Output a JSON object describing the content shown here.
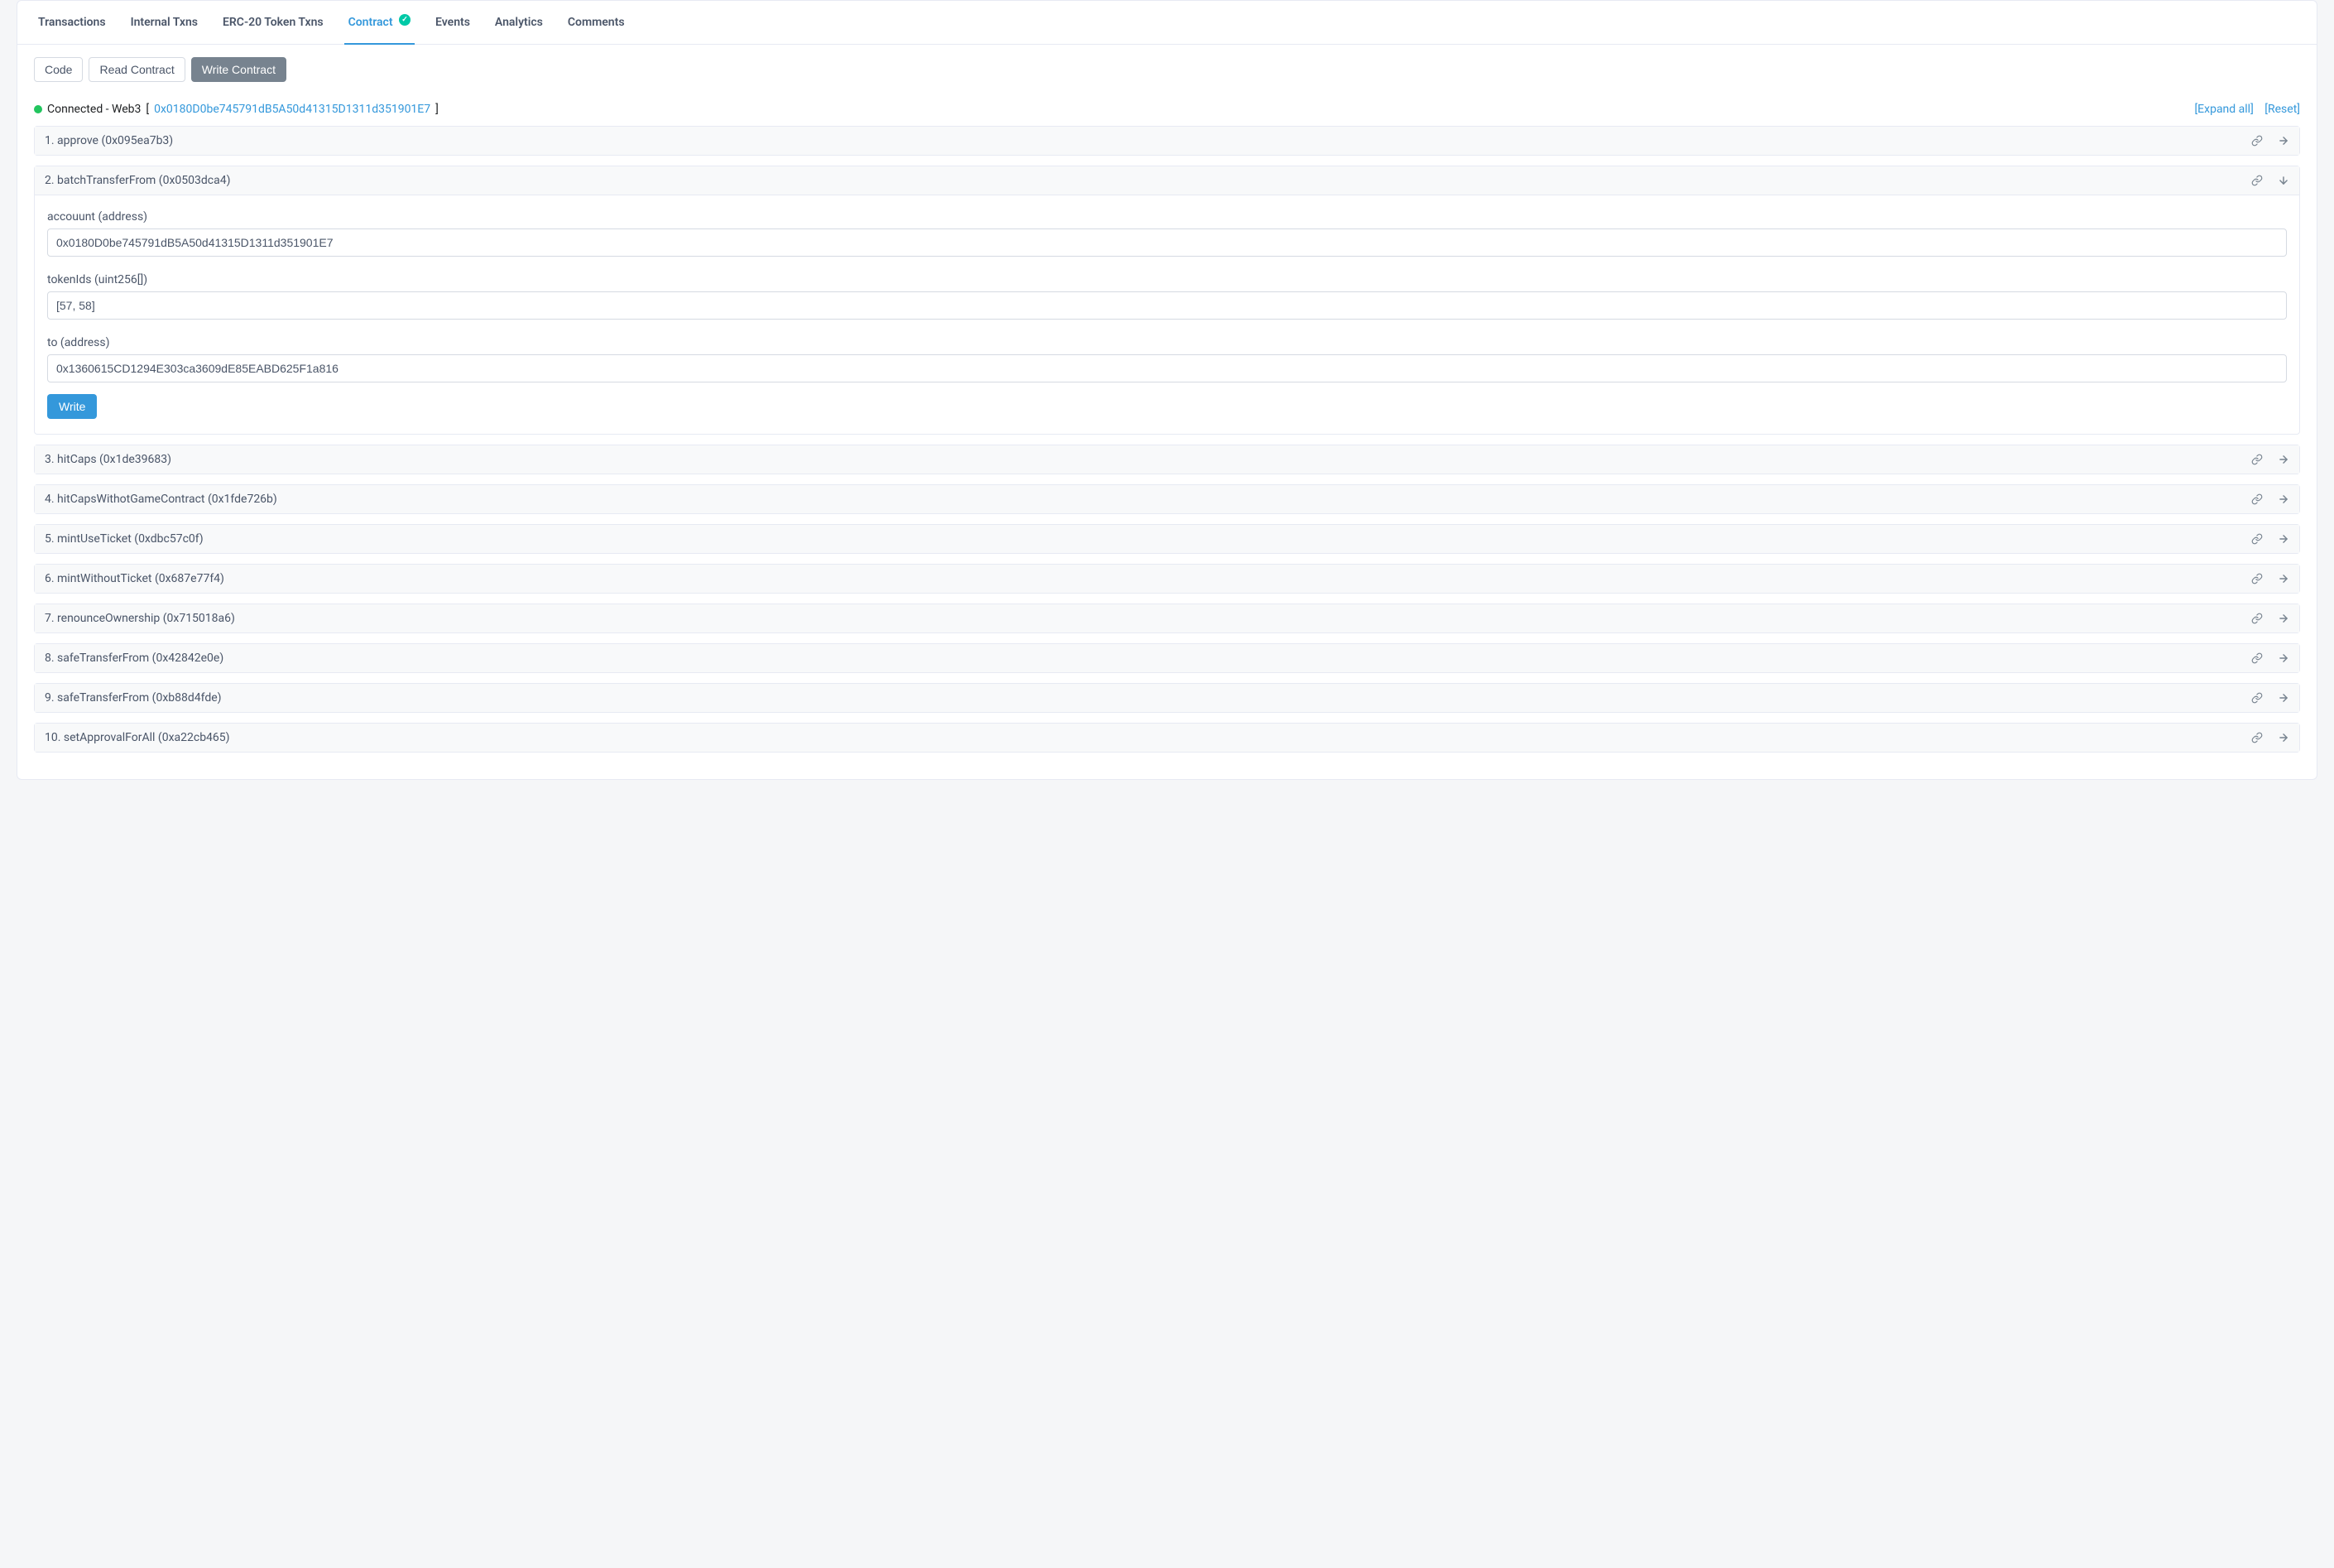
{
  "tabs": {
    "transactions": "Transactions",
    "internal_txns": "Internal Txns",
    "erc20": "ERC-20 Token Txns",
    "contract": "Contract",
    "events": "Events",
    "analytics": "Analytics",
    "comments": "Comments"
  },
  "subtabs": {
    "code": "Code",
    "read": "Read Contract",
    "write": "Write Contract"
  },
  "status": {
    "connected_label": "Connected - Web3",
    "address": "0x0180D0be745791dB5A50d41315D1311d351901E7",
    "expand_all": "[Expand all]",
    "reset": "[Reset]"
  },
  "functions": [
    {
      "title": "1. approve (0x095ea7b3)",
      "expanded": false
    },
    {
      "title": "2. batchTransferFrom (0x0503dca4)",
      "expanded": true,
      "fields": [
        {
          "label": "accouunt (address)",
          "placeholder": "accouunt (address)",
          "value": "0x0180D0be745791dB5A50d41315D1311d351901E7"
        },
        {
          "label": "tokenIds (uint256[])",
          "placeholder": "tokenIds (uint256[])",
          "value": "[57, 58]"
        },
        {
          "label": "to (address)",
          "placeholder": "to (address)",
          "value": "0x1360615CD1294E303ca3609dE85EABD625F1a816"
        }
      ],
      "write_label": "Write"
    },
    {
      "title": "3. hitCaps (0x1de39683)",
      "expanded": false
    },
    {
      "title": "4. hitCapsWithotGameContract (0x1fde726b)",
      "expanded": false
    },
    {
      "title": "5. mintUseTicket (0xdbc57c0f)",
      "expanded": false
    },
    {
      "title": "6. mintWithoutTicket (0x687e77f4)",
      "expanded": false
    },
    {
      "title": "7. renounceOwnership (0x715018a6)",
      "expanded": false
    },
    {
      "title": "8. safeTransferFrom (0x42842e0e)",
      "expanded": false
    },
    {
      "title": "9. safeTransferFrom (0xb88d4fde)",
      "expanded": false
    },
    {
      "title": "10. setApprovalForAll (0xa22cb465)",
      "expanded": false
    }
  ]
}
